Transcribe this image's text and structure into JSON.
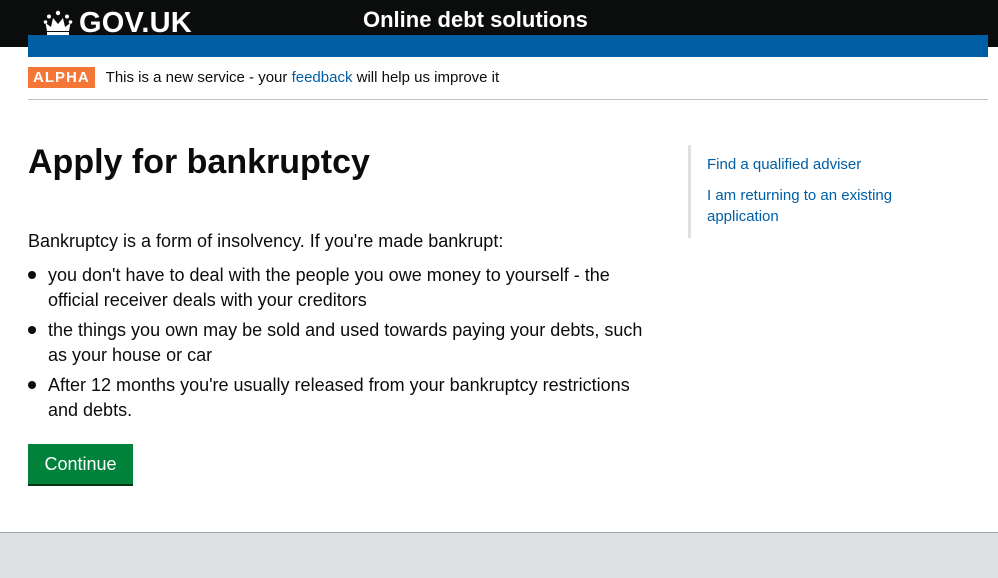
{
  "header": {
    "logo_text": "GOV.UK",
    "logo_icon": "crown-icon",
    "service_name": "Online debt solutions"
  },
  "phase_banner": {
    "tag": "ALPHA",
    "text_before": "This is a new service - your ",
    "link": "feedback",
    "text_after": " will help us improve it"
  },
  "main": {
    "title": "Apply for bankruptcy",
    "intro": "Bankruptcy is a form of insolvency. If you're made bankrupt:",
    "bullets": [
      "you don't have to deal with the people you owe money to yourself - the official receiver deals with your creditors",
      "the things you own may be sold and used towards paying your debts, such as your house or car",
      "After 12 months you're usually released from your bankruptcy restrictions and debts."
    ],
    "continue_label": "Continue"
  },
  "sidebar": {
    "links": [
      "Find a qualified adviser",
      "I am returning to an existing application"
    ]
  },
  "colors": {
    "header_bg": "#0b0c0c",
    "brand_blue": "#005ea5",
    "alpha_orange": "#f47738",
    "button_green": "#00823b",
    "footer_bg": "#dee0e2"
  }
}
